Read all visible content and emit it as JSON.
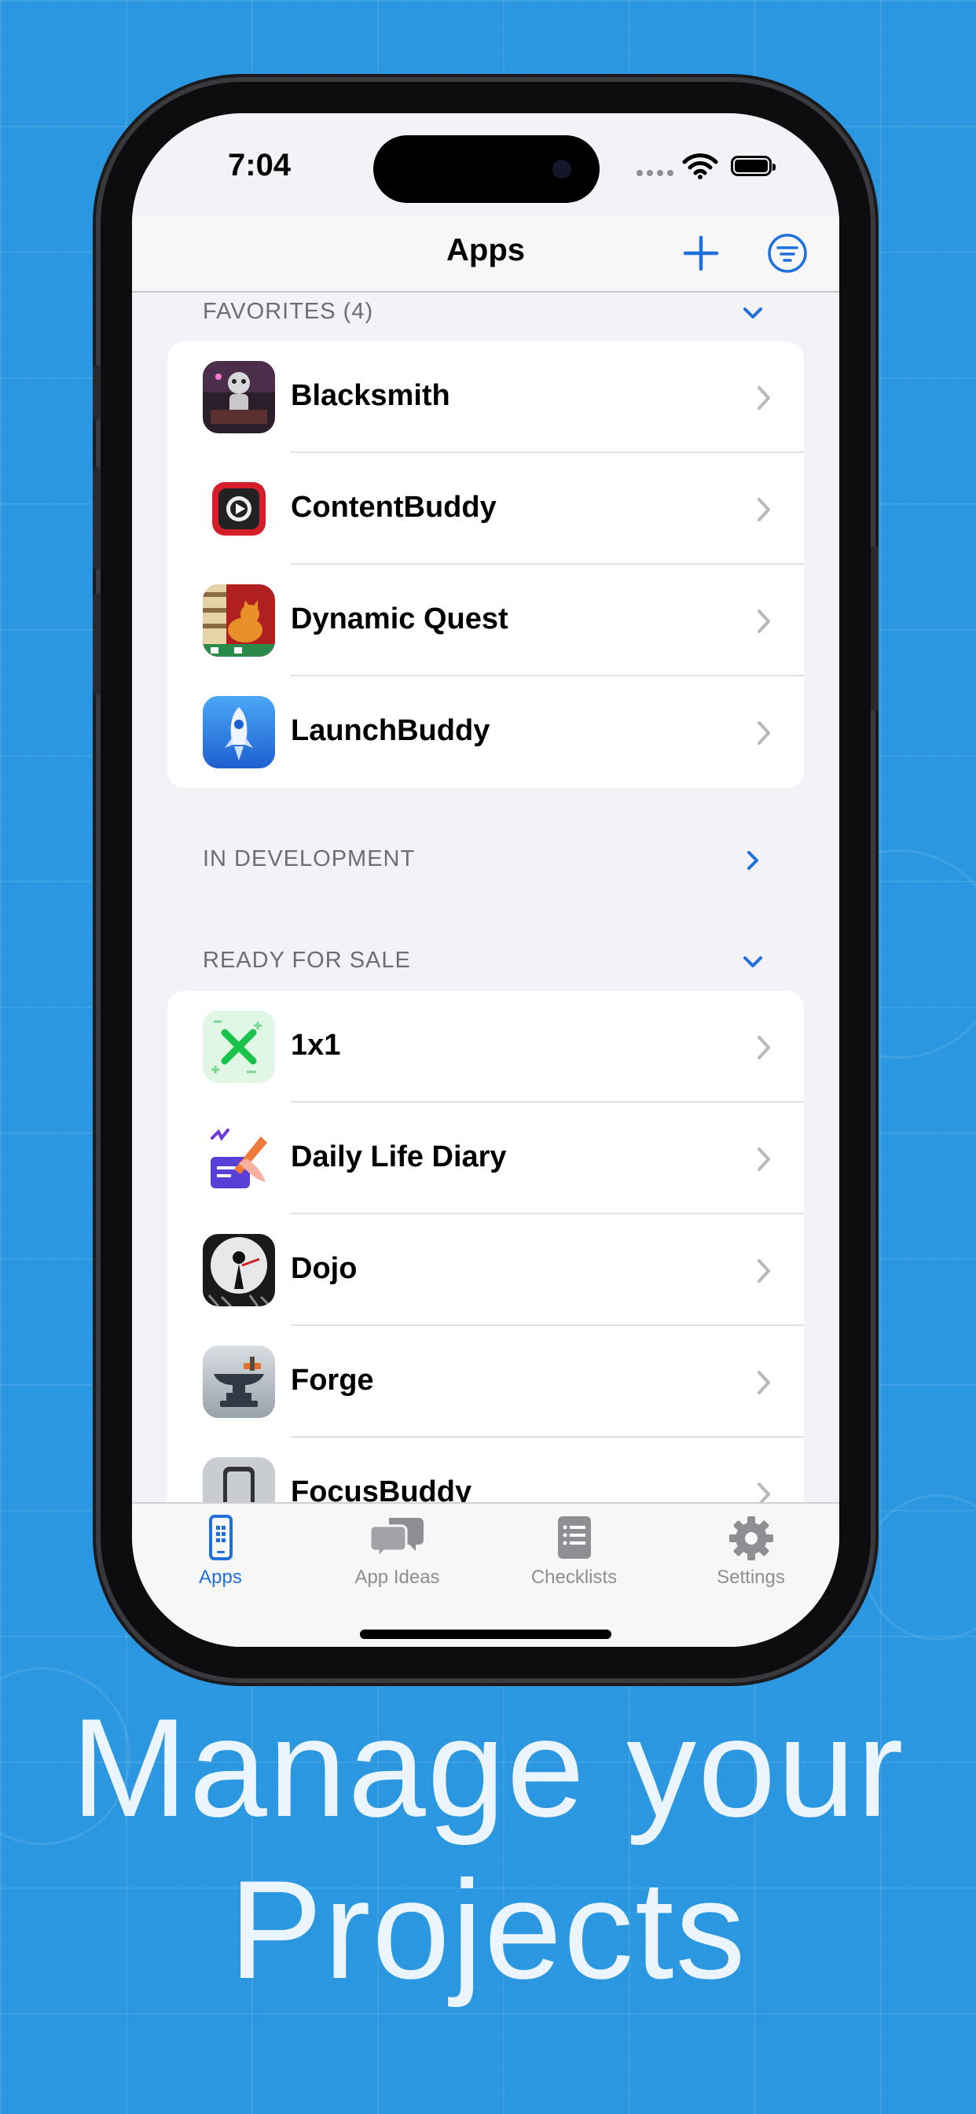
{
  "status": {
    "time": "7:04"
  },
  "navbar": {
    "title": "Apps"
  },
  "sections": {
    "favorites": {
      "title": "FAVORITES (4)",
      "items": [
        {
          "name": "Blacksmith"
        },
        {
          "name": "ContentBuddy"
        },
        {
          "name": "Dynamic Quest"
        },
        {
          "name": "LaunchBuddy"
        }
      ]
    },
    "in_development": {
      "title": "IN DEVELOPMENT"
    },
    "ready_for_sale": {
      "title": "READY FOR SALE",
      "items": [
        {
          "name": "1x1"
        },
        {
          "name": "Daily Life Diary"
        },
        {
          "name": "Dojo"
        },
        {
          "name": "Forge"
        },
        {
          "name": "FocusBuddy"
        }
      ]
    }
  },
  "tabs": [
    {
      "label": "Apps",
      "icon": "phone-icon",
      "active": true
    },
    {
      "label": "App Ideas",
      "icon": "chat-bubbles-icon",
      "active": false
    },
    {
      "label": "Checklists",
      "icon": "checklist-icon",
      "active": false
    },
    {
      "label": "Settings",
      "icon": "gear-icon",
      "active": false
    }
  ],
  "headline": {
    "line1": "Manage your",
    "line2": "Projects"
  },
  "colors": {
    "background": "#2a97e0",
    "accent": "#1f6fdc",
    "headline": "#eaf5ff"
  }
}
